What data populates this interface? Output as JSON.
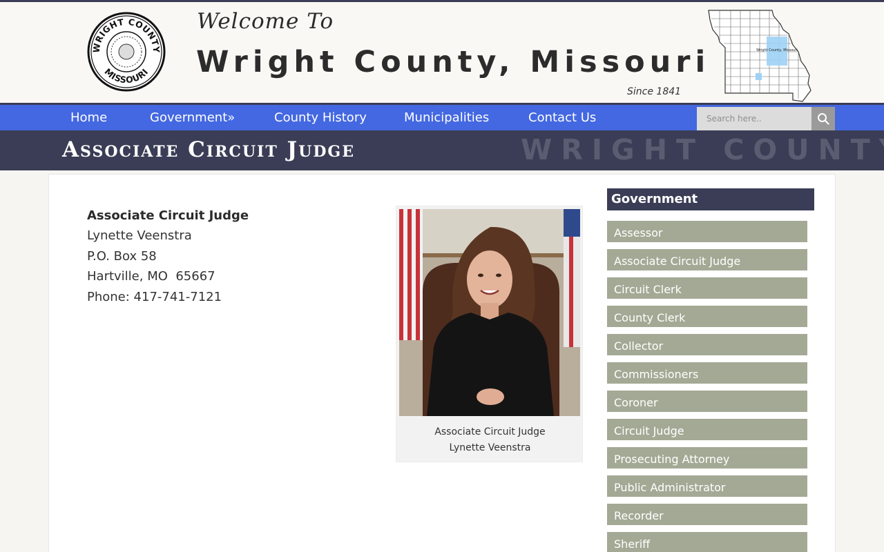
{
  "header": {
    "welcome": "Welcome To",
    "title": "Wright County, Missouri",
    "since": "Since 1841",
    "seal_text_top": "WRIGHT COUNTY",
    "seal_text_bottom": "MISSOURI",
    "map_label": "Wright County, Missouri"
  },
  "nav": {
    "items": [
      "Home",
      "Government»",
      "County History",
      "Municipalities",
      "Contact Us"
    ],
    "search_placeholder": "Search here.."
  },
  "page": {
    "title": "Associate Circuit Judge",
    "watermark": "WRIGHT COUNTY, MO"
  },
  "contact": {
    "heading": "Associate Circuit Judge",
    "name": "Lynette Veenstra",
    "address1": "P.O. Box 58",
    "address2": "Hartville, MO  65667",
    "phone": "Phone: 417-741-7121"
  },
  "photo": {
    "caption_line1": "Associate Circuit Judge",
    "caption_line2": "Lynette Veenstra"
  },
  "sidebar": {
    "heading": "Government",
    "items": [
      "Assessor",
      "Associate Circuit Judge",
      "Circuit Clerk",
      "County Clerk",
      "Collector",
      "Commissioners",
      "Coroner",
      "Circuit Judge",
      "Prosecuting Attorney",
      "Public Administrator",
      "Recorder",
      "Sheriff"
    ]
  },
  "colors": {
    "nav": "#4468e1",
    "band": "#3a3d55",
    "sidebar_item": "#a4a995"
  }
}
